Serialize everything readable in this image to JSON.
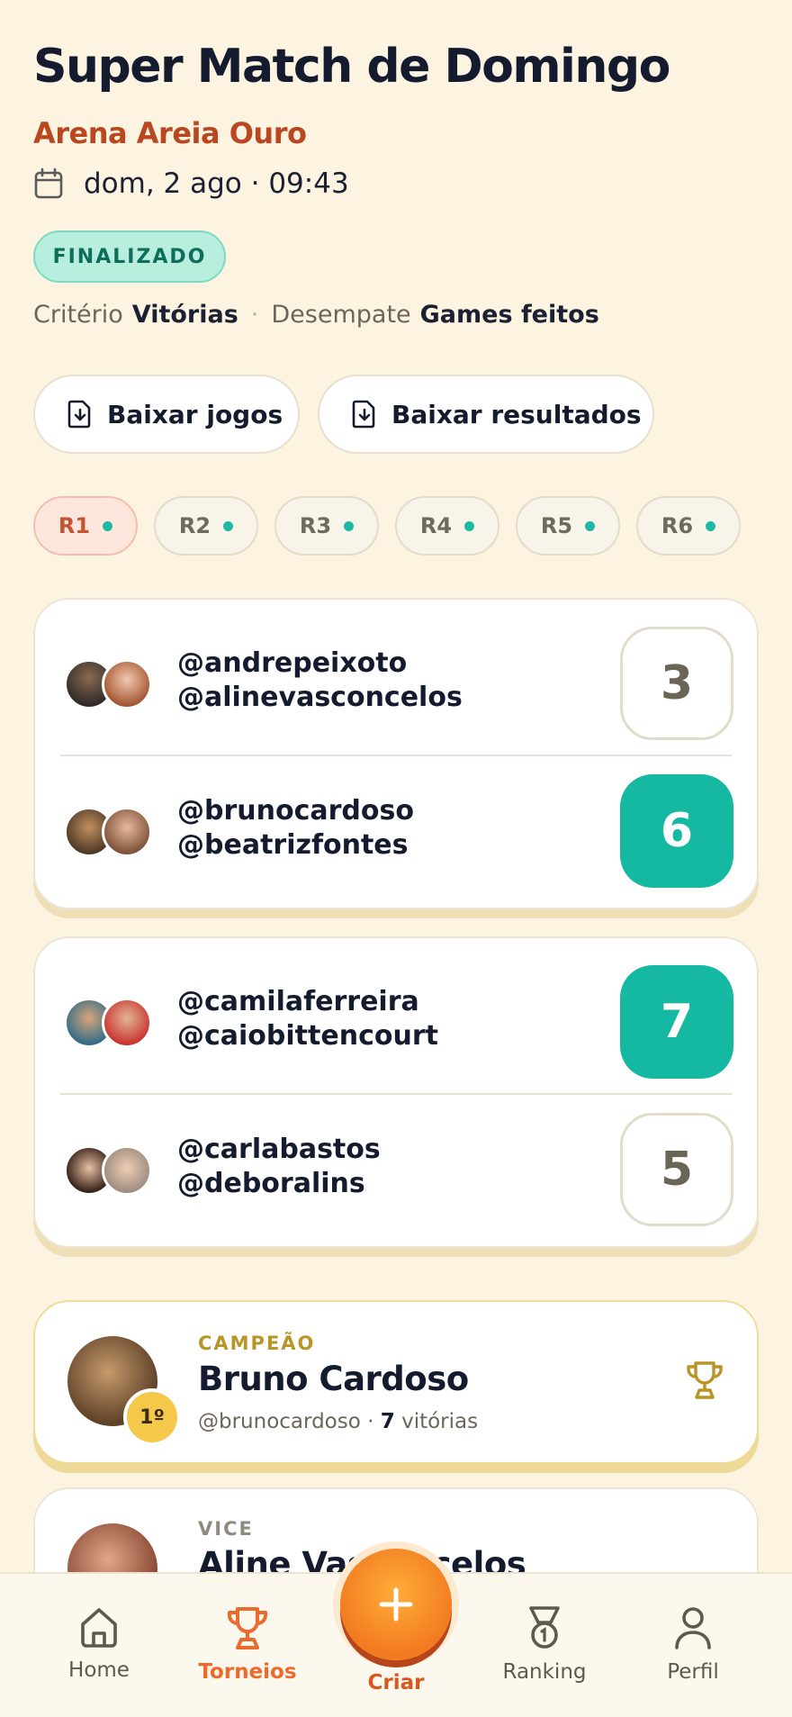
{
  "header": {
    "title": "Super Match de Domingo",
    "venue": "Arena Areia Ouro",
    "date": "dom, 2 ago · 09:43",
    "status": "FINALIZADO"
  },
  "criteria": {
    "criterion_label": "Critério",
    "criterion_value": "Vitórias",
    "separator": "·",
    "tiebreak_label": "Desempate",
    "tiebreak_value": "Games feitos"
  },
  "actions": {
    "download_games": "Baixar jogos",
    "download_results": "Baixar resultados"
  },
  "rounds": [
    {
      "label": "R1",
      "active": true
    },
    {
      "label": "R2",
      "active": false
    },
    {
      "label": "R3",
      "active": false
    },
    {
      "label": "R4",
      "active": false
    },
    {
      "label": "R5",
      "active": false
    },
    {
      "label": "R6",
      "active": false
    }
  ],
  "matches": [
    {
      "team1": {
        "player1": "@andrepeixoto",
        "player2": "@alinevasconcelos",
        "score": "3",
        "winner": false
      },
      "team2": {
        "player1": "@brunocardoso",
        "player2": "@beatrizfontes",
        "score": "6",
        "winner": true
      }
    },
    {
      "team1": {
        "player1": "@camilaferreira",
        "player2": "@caiobittencourt",
        "score": "7",
        "winner": true
      },
      "team2": {
        "player1": "@carlabastos",
        "player2": "@deboralins",
        "score": "5",
        "winner": false
      }
    }
  ],
  "podium": {
    "champion": {
      "label": "CAMPEÃO",
      "name": "Bruno Cardoso",
      "handle": "@brunocardoso",
      "separator": " · ",
      "wins": "7",
      "wins_label": " vitórias",
      "position": "1º"
    },
    "vice": {
      "label": "VICE",
      "name": "Aline Vasconcelos"
    }
  },
  "nav": {
    "home": "Home",
    "tournaments": "Torneios",
    "create": "Criar",
    "ranking": "Ranking",
    "profile": "Perfil"
  },
  "colors": {
    "background": "#fcf3e1",
    "accent": "#ec6a2c",
    "win": "#15b8a1",
    "venue": "#b9471f",
    "gold": "#b99426"
  }
}
